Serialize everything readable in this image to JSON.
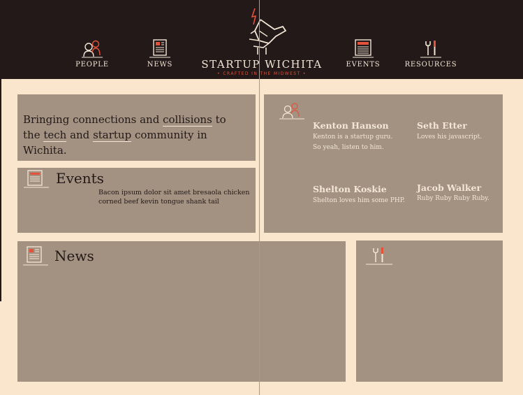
{
  "header": {
    "nav": {
      "people": "PEOPLE",
      "news": "NEWS",
      "events": "EVENTS",
      "resources": "RESOURCES"
    },
    "logo": {
      "title": "STARTUP WICHITA",
      "subtitle": "• CRAFTED IN THE MIDWEST •"
    }
  },
  "intro": {
    "line1_a": "Bringing connections and ",
    "line1_link": "collisions",
    "line1_b": " to",
    "line2_a": "the ",
    "line2_link1": "tech",
    "line2_b": " and ",
    "line2_link2": "startup",
    "line2_c": " community in Wichita."
  },
  "events": {
    "title": "Events",
    "body": "Bacon ipsum dolor sit amet bresaola chicken corned beef kevin tongue shank tail"
  },
  "people": {
    "members": [
      {
        "name": "Kenton Hanson",
        "bio1": "Kenton is a startup guru.",
        "bio2": "So yeah, listen to him."
      },
      {
        "name": "Seth Etter",
        "bio1": "Loves his javascript.",
        "bio2": ""
      },
      {
        "name": "Shelton Koskie",
        "bio1": "Shelton loves him some PHP.",
        "bio2": ""
      },
      {
        "name": "Jacob Walker",
        "bio1": "Ruby Ruby Ruby Ruby.",
        "bio2": ""
      }
    ]
  },
  "news": {
    "title": "News"
  },
  "icons": {
    "people": "people-icon",
    "news": "newspaper-icon",
    "events": "calendar-icon",
    "resources": "tools-icon",
    "logo": "rocket-hand-icon"
  },
  "colors": {
    "header_bg": "#231918",
    "page_bg": "#fae6cc",
    "panel_bg": "#a39281",
    "accent": "#e4523b",
    "light_text": "#f3e6d6",
    "dark_text": "#231918"
  }
}
